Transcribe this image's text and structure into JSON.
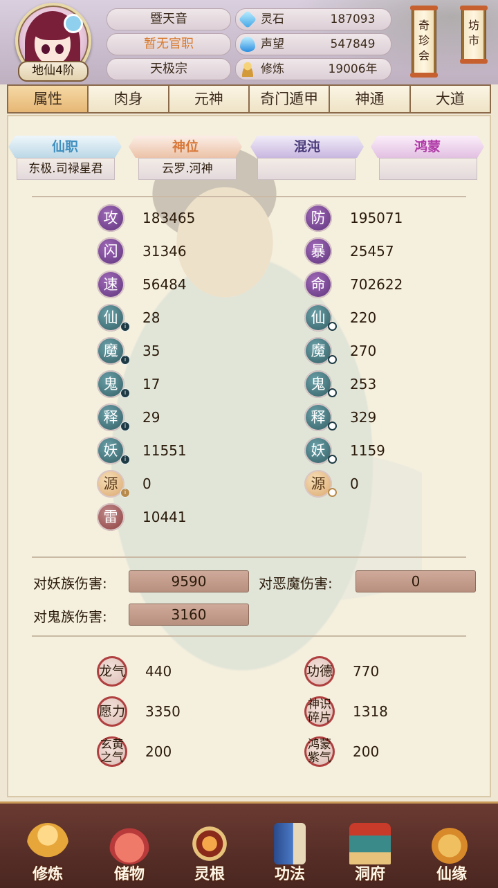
{
  "header": {
    "rank_badge": "地仙4阶",
    "name": "暨天音",
    "official_title": "暂无官职",
    "sect": "天极宗",
    "resources": [
      {
        "icon": "spirit-stone-icon",
        "label": "灵石",
        "value": "187093"
      },
      {
        "icon": "prestige-icon",
        "label": "声望",
        "value": "547849"
      },
      {
        "icon": "cultivation-icon",
        "label": "修炼",
        "value": "19006年"
      }
    ],
    "buttons": {
      "treasure_fair": "奇珍会",
      "market": "坊市"
    }
  },
  "tabs": [
    "属性",
    "肉身",
    "元神",
    "奇门遁甲",
    "神通",
    "大道"
  ],
  "active_tab": "属性",
  "posts": [
    {
      "label": "仙职",
      "value": "东极.司禄星君"
    },
    {
      "label": "神位",
      "value": "云罗.河神"
    },
    {
      "label": "混沌",
      "value": ""
    },
    {
      "label": "鸿蒙",
      "value": ""
    }
  ],
  "stats_left": [
    {
      "icon": "攻",
      "value": "183465"
    },
    {
      "icon": "闪",
      "value": "31346"
    },
    {
      "icon": "速",
      "value": "56484"
    },
    {
      "icon": "仙",
      "value": "28"
    },
    {
      "icon": "魔",
      "value": "35"
    },
    {
      "icon": "鬼",
      "value": "17"
    },
    {
      "icon": "释",
      "value": "29"
    },
    {
      "icon": "妖",
      "value": "11551"
    },
    {
      "icon": "源",
      "value": "0"
    },
    {
      "icon": "雷",
      "value": "10441"
    }
  ],
  "stats_right": [
    {
      "icon": "防",
      "value": "195071"
    },
    {
      "icon": "暴",
      "value": "25457"
    },
    {
      "icon": "命",
      "value": "702622"
    },
    {
      "icon": "仙",
      "value": "220"
    },
    {
      "icon": "魔",
      "value": "270"
    },
    {
      "icon": "鬼",
      "value": "253"
    },
    {
      "icon": "释",
      "value": "329"
    },
    {
      "icon": "妖",
      "value": "1159"
    },
    {
      "icon": "源",
      "value": "0"
    }
  ],
  "damage": [
    {
      "label": "对妖族伤害:",
      "value": "9590"
    },
    {
      "label": "对恶魔伤害:",
      "value": "0"
    },
    {
      "label": "对鬼族伤害:",
      "value": "3160"
    }
  ],
  "misc_left": [
    {
      "icon": "龙气",
      "value": "440"
    },
    {
      "icon": "愿力",
      "value": "3350"
    },
    {
      "icon": "玄黄之气",
      "value": "200"
    }
  ],
  "misc_right": [
    {
      "icon": "功德",
      "value": "770"
    },
    {
      "icon": "神识碎片",
      "value": "1318"
    },
    {
      "icon": "鸿蒙紫气",
      "value": "200"
    }
  ],
  "bottom_nav": [
    {
      "label": "修炼",
      "icon": "cultivate-icon"
    },
    {
      "label": "储物",
      "icon": "storage-bag-icon"
    },
    {
      "label": "灵根",
      "icon": "spirit-root-icon"
    },
    {
      "label": "功法",
      "icon": "technique-book-icon"
    },
    {
      "label": "洞府",
      "icon": "cave-mansion-icon"
    },
    {
      "label": "仙缘",
      "icon": "immortal-fate-icon"
    }
  ]
}
